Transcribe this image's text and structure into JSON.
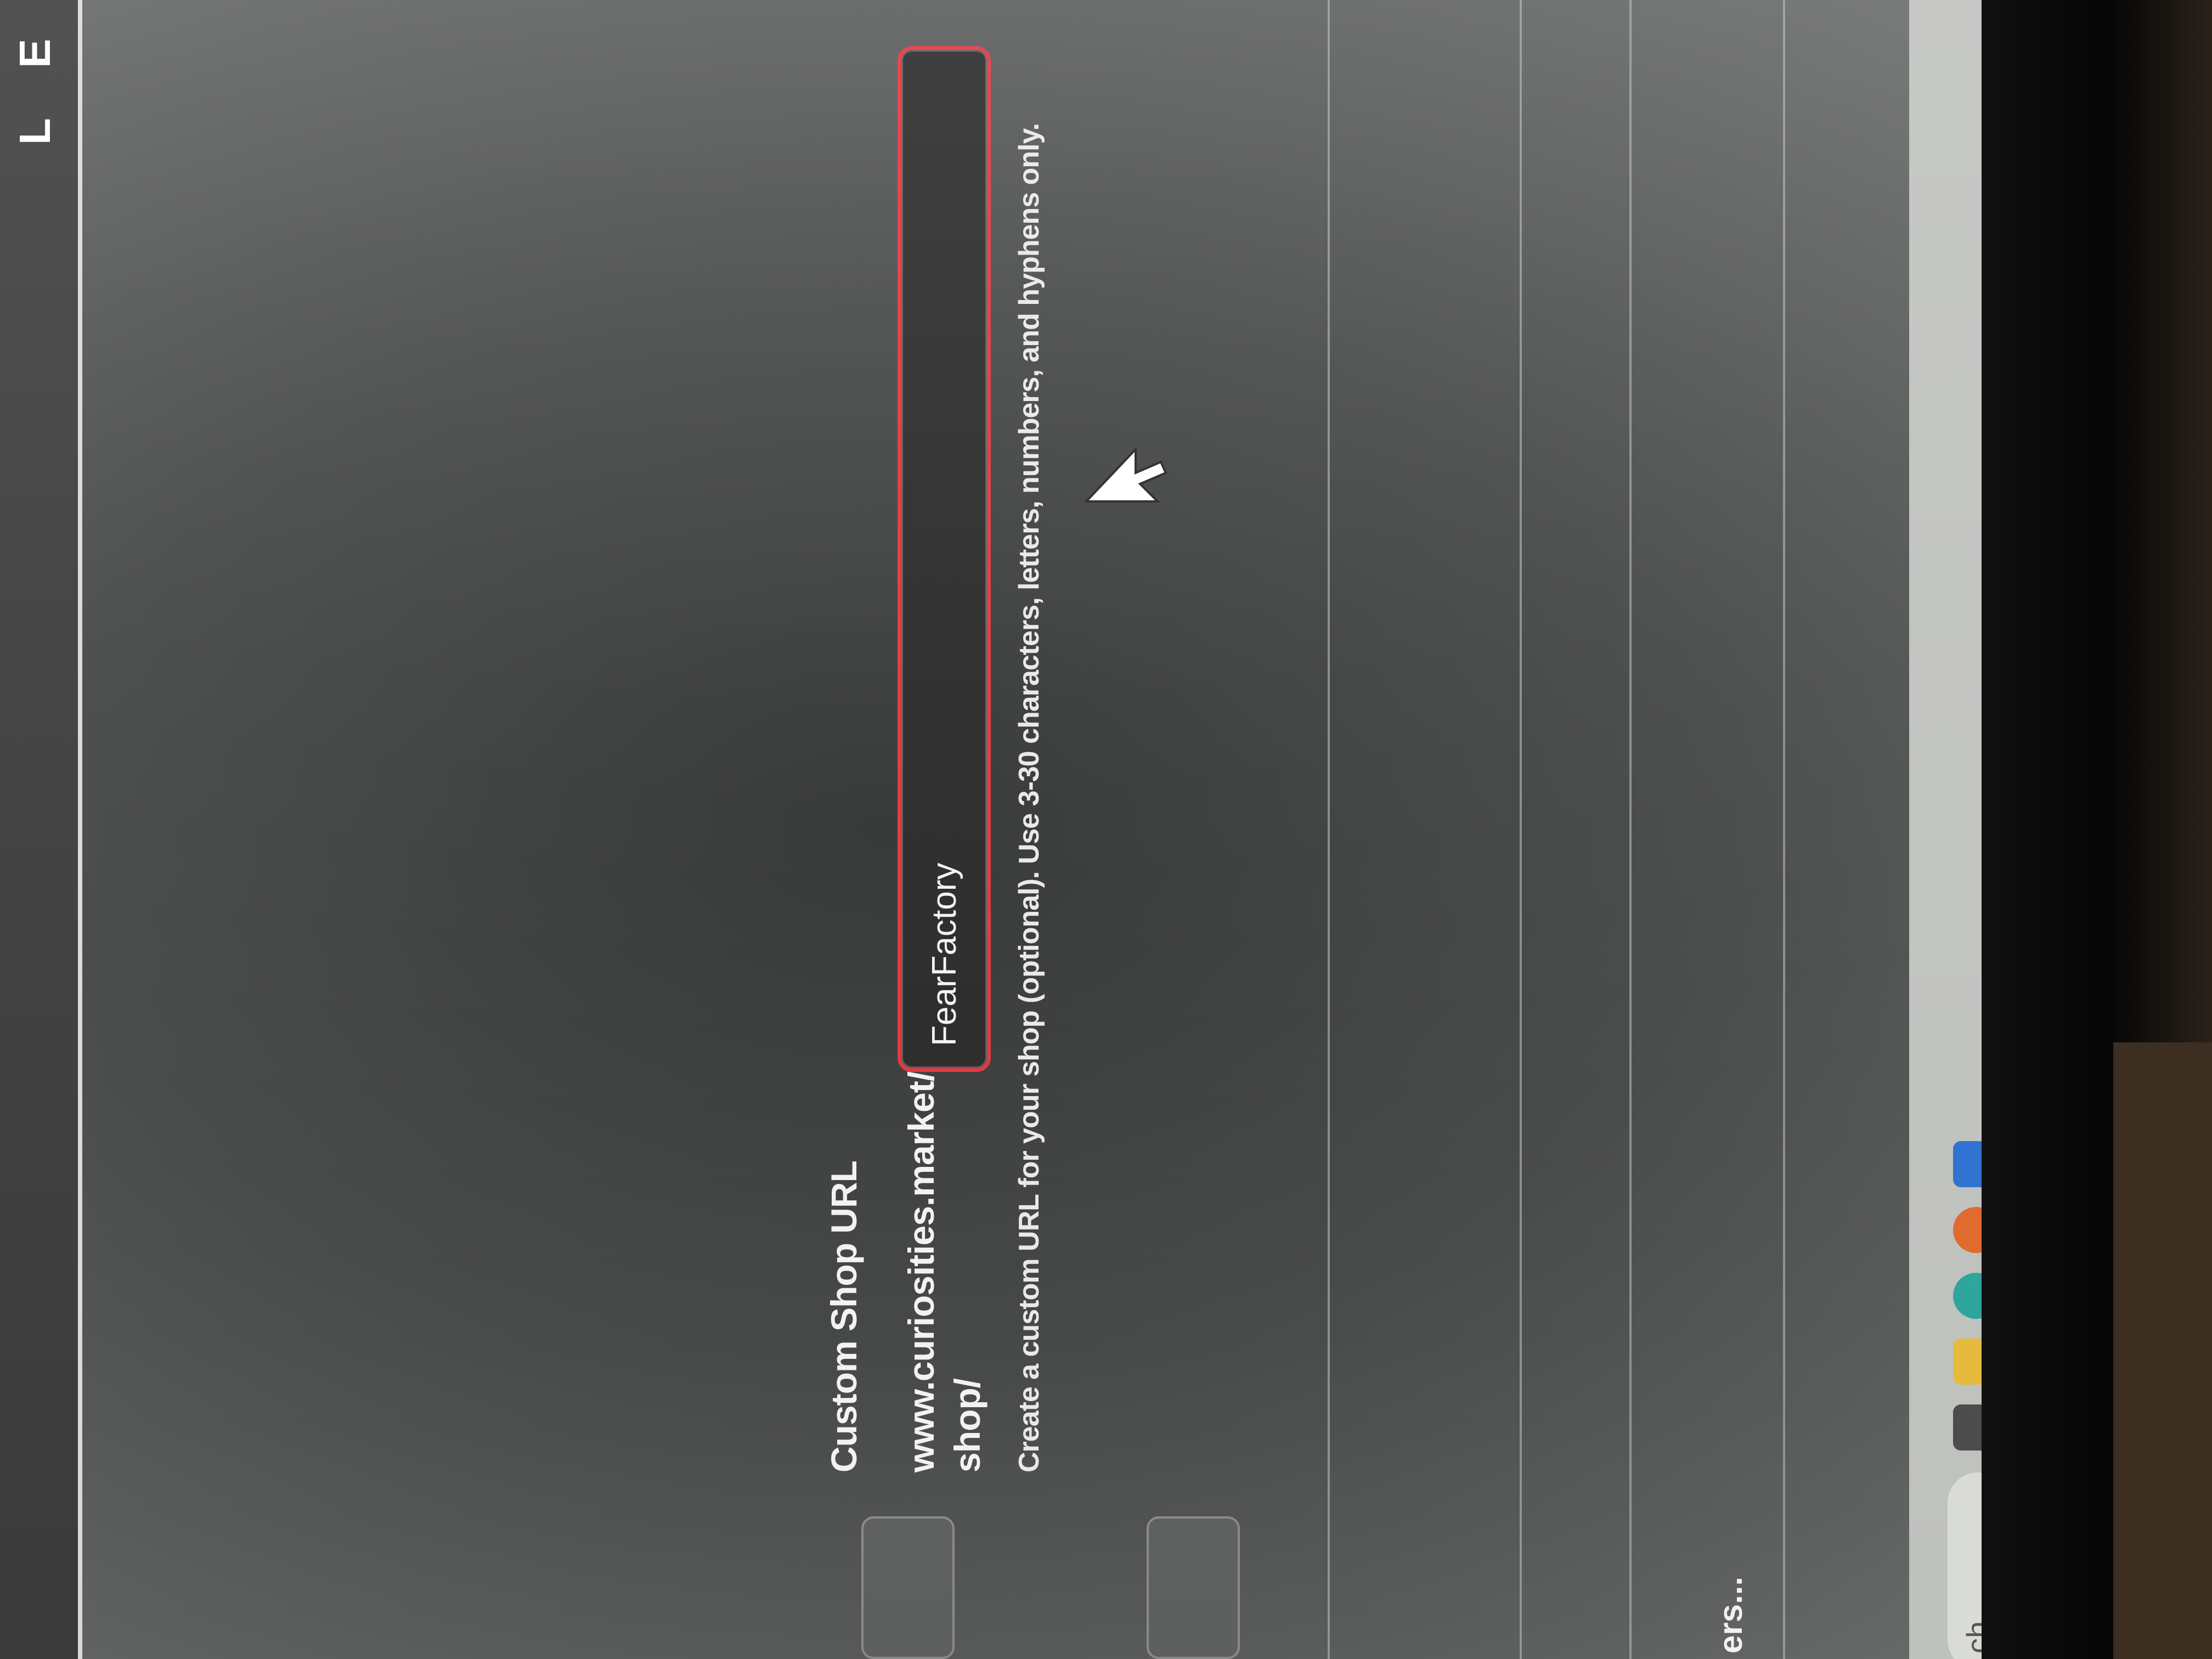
{
  "form": {
    "label": "Custom Shop URL",
    "url_prefix": "www.curiosities.market/ shop/",
    "shop_url_value": "FearFactory",
    "hint": "Create a custom URL for your shop (optional). Use 3-30 characters, letters, numbers, and hyphens only."
  },
  "fragments": {
    "top_left_1": "E",
    "top_left_2": "L",
    "bottom_text": "ers...",
    "search_partial": "ch"
  },
  "colors": {
    "error_border": "#e0323c"
  },
  "taskbar": {
    "icons": [
      "task-view-icon",
      "file-explorer-icon",
      "edge-icon",
      "firefox-icon",
      "outlook-icon"
    ]
  }
}
